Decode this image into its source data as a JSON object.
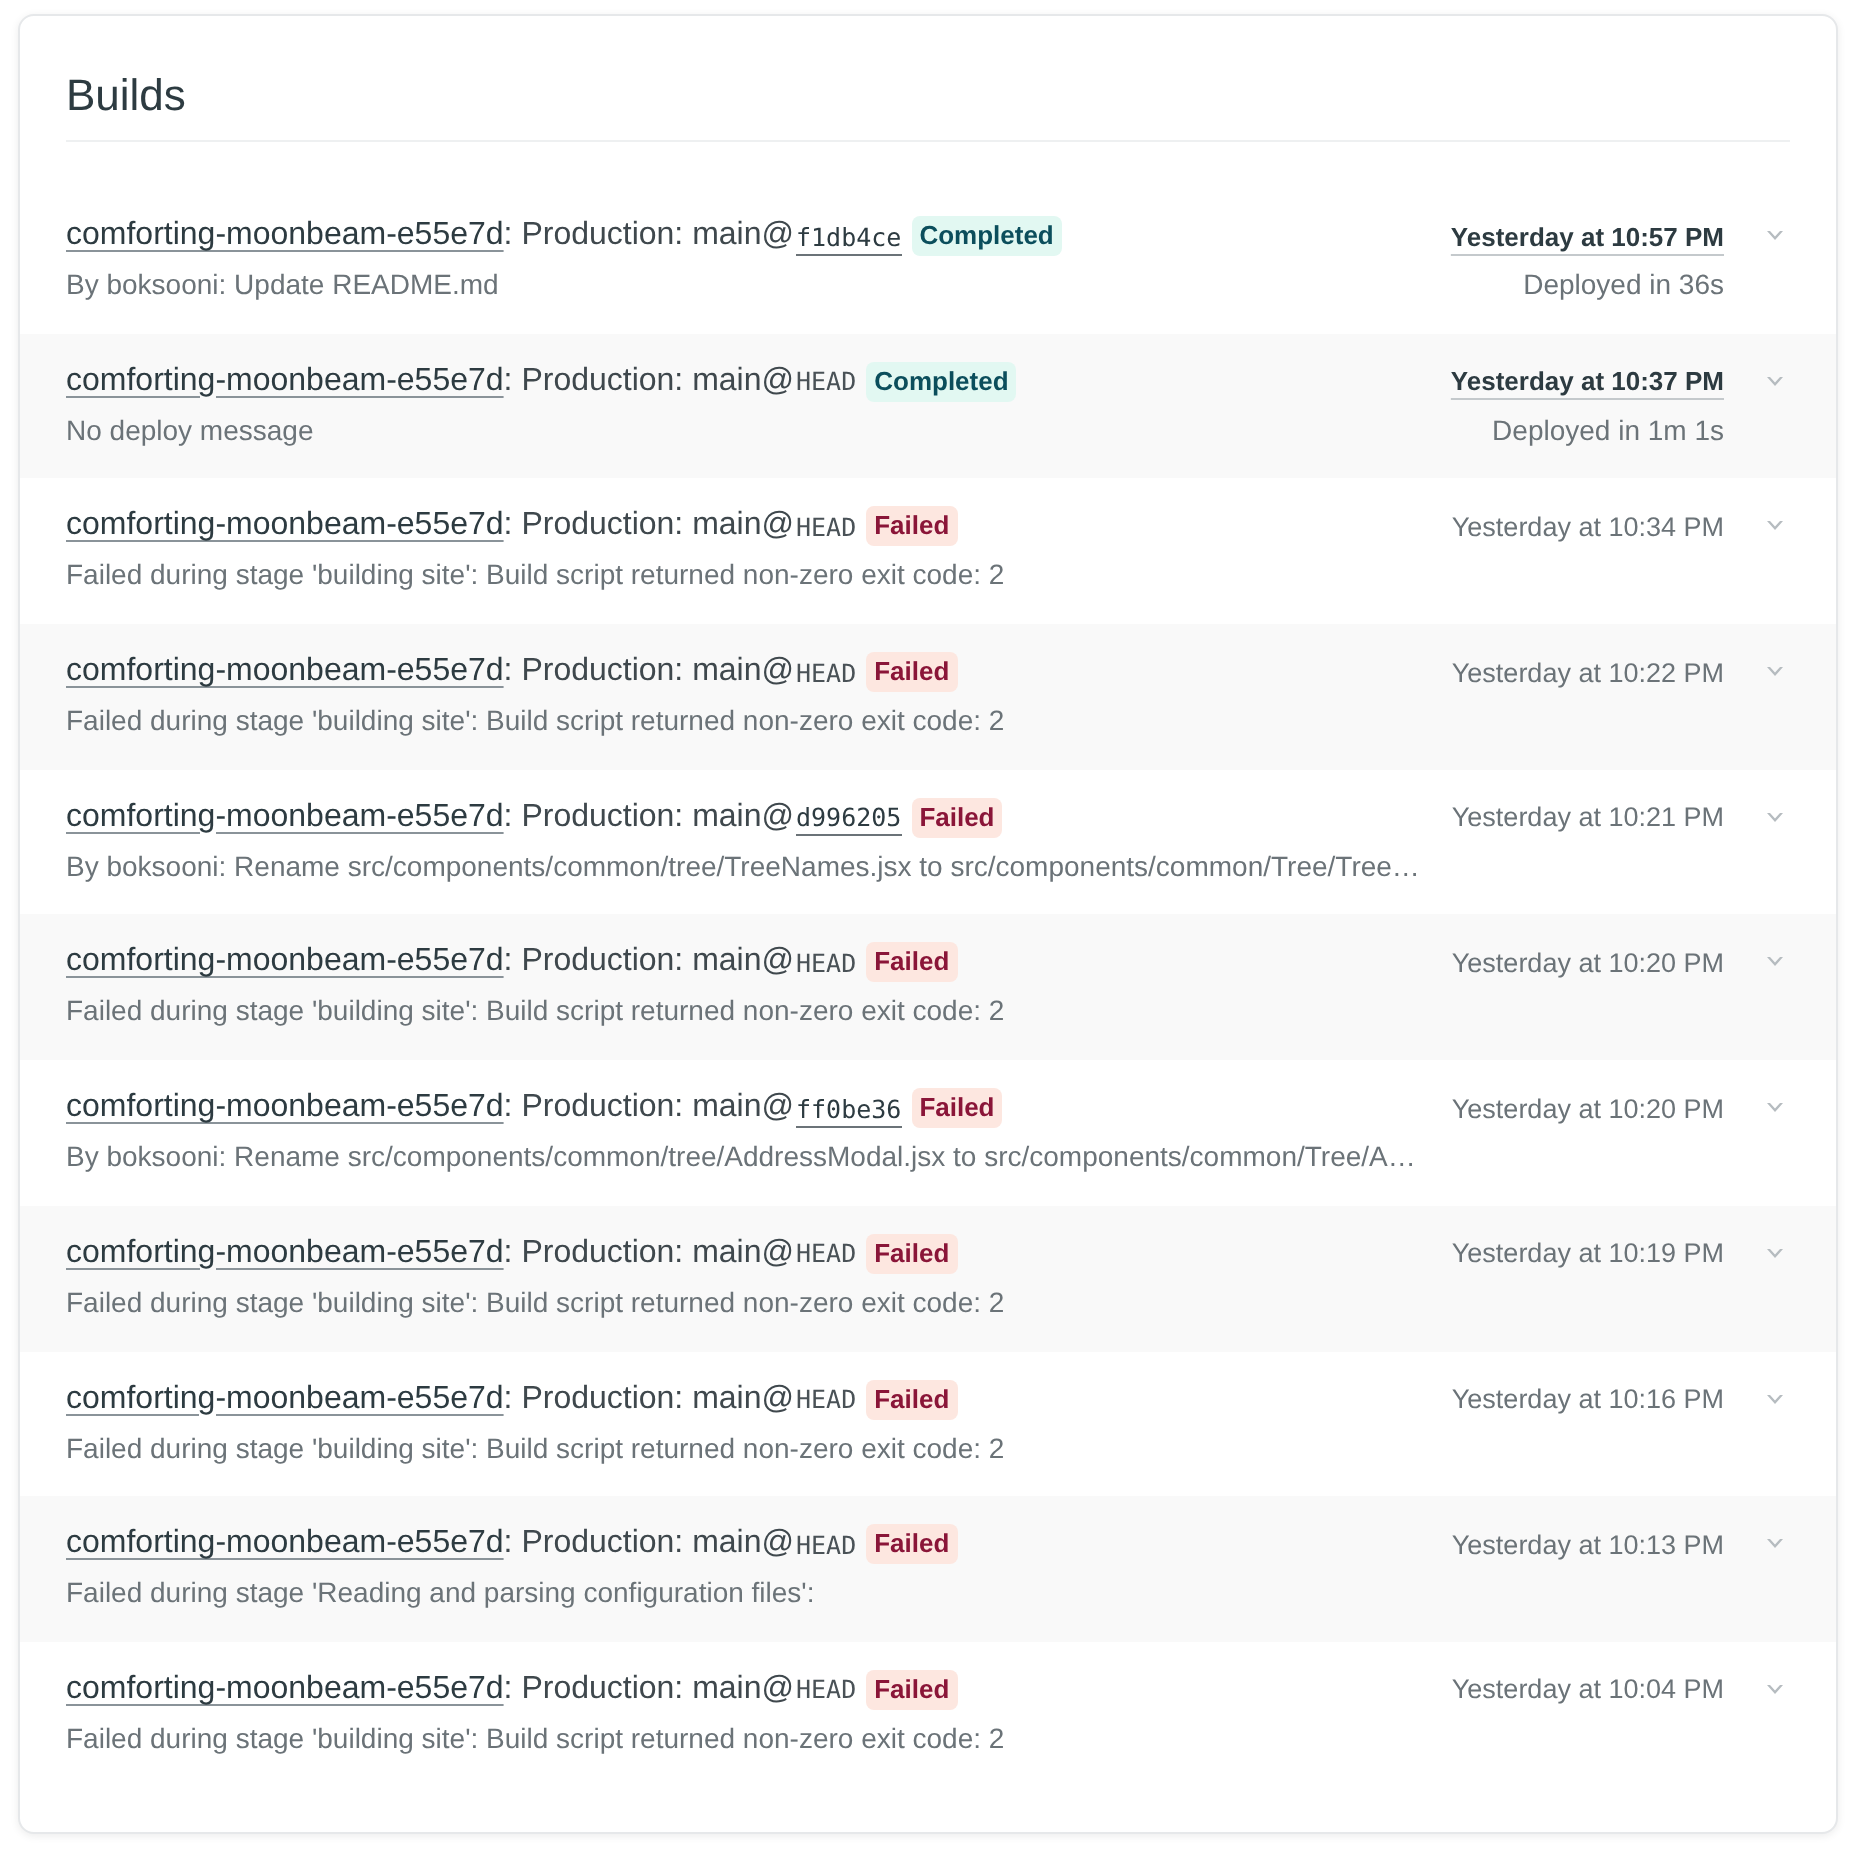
{
  "title": "Builds",
  "builds": [
    {
      "site": "comforting-moonbeam-e55e7d",
      "label": ": Production: main@",
      "ref": "f1db4ce",
      "ref_linked": true,
      "status": {
        "kind": "completed",
        "label": "Completed"
      },
      "message": "By boksooni: Update README.md",
      "time": "Yesterday at 10:57 PM",
      "time_highlighted": true,
      "duration": "Deployed in 36s"
    },
    {
      "site": "comforting-moonbeam-e55e7d",
      "label": ": Production: main@",
      "ref": "HEAD",
      "ref_linked": false,
      "status": {
        "kind": "completed",
        "label": "Completed"
      },
      "message": "No deploy message",
      "time": "Yesterday at 10:37 PM",
      "time_highlighted": true,
      "duration": "Deployed in 1m 1s"
    },
    {
      "site": "comforting-moonbeam-e55e7d",
      "label": ": Production: main@",
      "ref": "HEAD",
      "ref_linked": false,
      "status": {
        "kind": "failed",
        "label": "Failed"
      },
      "message": "Failed during stage 'building site': Build script returned non-zero exit code: 2",
      "time": "Yesterday at 10:34 PM",
      "time_highlighted": false
    },
    {
      "site": "comforting-moonbeam-e55e7d",
      "label": ": Production: main@",
      "ref": "HEAD",
      "ref_linked": false,
      "status": {
        "kind": "failed",
        "label": "Failed"
      },
      "message": "Failed during stage 'building site': Build script returned non-zero exit code: 2",
      "time": "Yesterday at 10:22 PM",
      "time_highlighted": false
    },
    {
      "site": "comforting-moonbeam-e55e7d",
      "label": ": Production: main@",
      "ref": "d996205",
      "ref_linked": true,
      "status": {
        "kind": "failed",
        "label": "Failed"
      },
      "message": "By boksooni: Rename src/components/common/tree/TreeNames.jsx to src/components/common/Tree/Tree…",
      "time": "Yesterday at 10:21 PM",
      "time_highlighted": false
    },
    {
      "site": "comforting-moonbeam-e55e7d",
      "label": ": Production: main@",
      "ref": "HEAD",
      "ref_linked": false,
      "status": {
        "kind": "failed",
        "label": "Failed"
      },
      "message": "Failed during stage 'building site': Build script returned non-zero exit code: 2",
      "time": "Yesterday at 10:20 PM",
      "time_highlighted": false
    },
    {
      "site": "comforting-moonbeam-e55e7d",
      "label": ": Production: main@",
      "ref": "ff0be36",
      "ref_linked": true,
      "status": {
        "kind": "failed",
        "label": "Failed"
      },
      "message": "By boksooni: Rename src/components/common/tree/AddressModal.jsx to src/components/common/Tree/A…",
      "time": "Yesterday at 10:20 PM",
      "time_highlighted": false
    },
    {
      "site": "comforting-moonbeam-e55e7d",
      "label": ": Production: main@",
      "ref": "HEAD",
      "ref_linked": false,
      "status": {
        "kind": "failed",
        "label": "Failed"
      },
      "message": "Failed during stage 'building site': Build script returned non-zero exit code: 2",
      "time": "Yesterday at 10:19 PM",
      "time_highlighted": false
    },
    {
      "site": "comforting-moonbeam-e55e7d",
      "label": ": Production: main@",
      "ref": "HEAD",
      "ref_linked": false,
      "status": {
        "kind": "failed",
        "label": "Failed"
      },
      "message": "Failed during stage 'building site': Build script returned non-zero exit code: 2",
      "time": "Yesterday at 10:16 PM",
      "time_highlighted": false
    },
    {
      "site": "comforting-moonbeam-e55e7d",
      "label": ": Production: main@",
      "ref": "HEAD",
      "ref_linked": false,
      "status": {
        "kind": "failed",
        "label": "Failed"
      },
      "message": "Failed during stage 'Reading and parsing configuration files':",
      "time": "Yesterday at 10:13 PM",
      "time_highlighted": false
    },
    {
      "site": "comforting-moonbeam-e55e7d",
      "label": ": Production: main@",
      "ref": "HEAD",
      "ref_linked": false,
      "status": {
        "kind": "failed",
        "label": "Failed"
      },
      "message": "Failed during stage 'building site': Build script returned non-zero exit code: 2",
      "time": "Yesterday at 10:04 PM",
      "time_highlighted": false
    }
  ]
}
